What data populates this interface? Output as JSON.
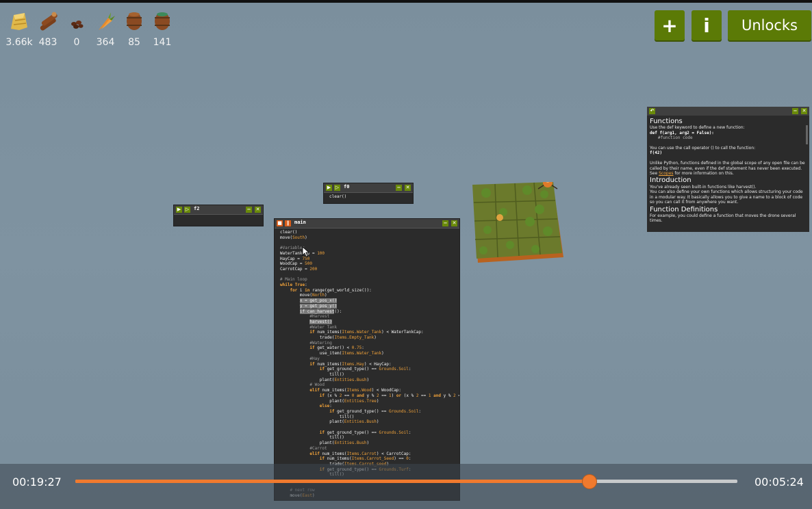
{
  "resources": [
    {
      "icon": "hay-icon",
      "value": "3.66k"
    },
    {
      "icon": "wood-icon",
      "value": "483"
    },
    {
      "icon": "seeds-icon",
      "value": "0"
    },
    {
      "icon": "carrot-icon",
      "value": "364"
    },
    {
      "icon": "pumpkin-barrel-icon",
      "value": "85"
    },
    {
      "icon": "water-barrel-icon",
      "value": "141"
    }
  ],
  "toolbar": {
    "add_label": "+",
    "info_label": "i",
    "unlocks_label": "Unlocks"
  },
  "windows": {
    "f2": {
      "title": "f2"
    },
    "f0": {
      "title": "f0",
      "code": "clear()"
    },
    "main": {
      "title": "main"
    }
  },
  "docs": {
    "h_functions": "Functions",
    "p1": "Use the def keyword to define a new function:",
    "code1": "def f(arg1, arg2 = False):",
    "code1b": "#function code",
    "p2": "You can use the call operator () to call the function:",
    "code2": "f(42)",
    "p3": "Unlike Python, functions defined in the global scope of any open file can be called by their name, even if the def statement has never been executed.",
    "p4_pre": "See ",
    "p4_link": "Scopes",
    "p4_post": " for more information on this.",
    "h_intro": "Introduction",
    "p5": "You've already seen built-in functions like harvest().",
    "p6": "You can also define your own functions which allows structuring your code in a modular way. It basically allows you to give a name to a block of code so you can call it from anywhere you want.",
    "h_defs": "Function Definitions",
    "p7": "For example, you could define a function that moves the drone several times."
  },
  "video": {
    "elapsed": "00:19:27",
    "remaining": "00:05:24",
    "progress": 0.777
  },
  "colors": {
    "accent": "#5b7a06",
    "progress": "#f07a2e",
    "keyword": "#f2a33a"
  }
}
